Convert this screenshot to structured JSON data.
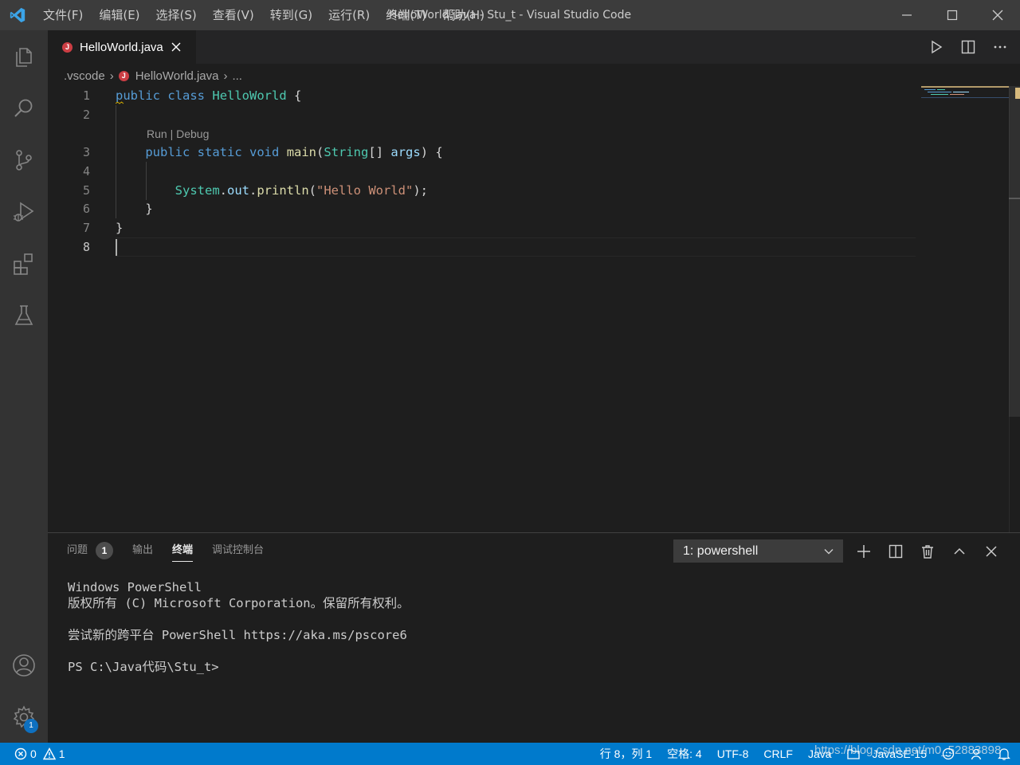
{
  "window": {
    "title": "HelloWorld.java - Stu_t - Visual Studio Code"
  },
  "menu": [
    "文件(F)",
    "编辑(E)",
    "选择(S)",
    "查看(V)",
    "转到(G)",
    "运行(R)",
    "终端(T)",
    "帮助(H)"
  ],
  "activity_bar": {
    "items": [
      "explorer-icon",
      "search-icon",
      "source-control-icon",
      "run-debug-icon",
      "extensions-icon",
      "testing-icon"
    ],
    "bottom": [
      "account-icon",
      "settings-gear-icon"
    ],
    "settings_badge": "1"
  },
  "tabs": [
    {
      "label": "HelloWorld.java",
      "icon": "J",
      "active": true
    }
  ],
  "breadcrumb": {
    "folder": ".vscode",
    "file": "HelloWorld.java",
    "more": "..."
  },
  "editor": {
    "line_numbers": [
      "1",
      "2",
      "3",
      "4",
      "5",
      "6",
      "7",
      "8"
    ],
    "codelens": "Run | Debug",
    "active_line": "8",
    "lines": {
      "l1_kw1": "public",
      "l1_kw2": "class",
      "l1_cls": "HelloWorld",
      "l1_rest": " {",
      "l3_kw1": "public",
      "l3_kw2": "static",
      "l3_kw3": "void",
      "l3_fn": "main",
      "l3_p1": "(",
      "l3_cls": "String",
      "l3_p2": "[] ",
      "l3_var": "args",
      "l3_p3": ") {",
      "l5_cls": "System",
      "l5_dot1": ".",
      "l5_var": "out",
      "l5_dot2": ".",
      "l5_fn": "println",
      "l5_p1": "(",
      "l5_str": "\"Hello World\"",
      "l5_p2": ");",
      "l6": "}",
      "l7": "}"
    }
  },
  "panel": {
    "tabs": [
      {
        "label": "问题",
        "badge": "1"
      },
      {
        "label": "输出"
      },
      {
        "label": "终端",
        "active": true
      },
      {
        "label": "调试控制台"
      }
    ],
    "terminal_select": "1: powershell",
    "terminal_lines": [
      "Windows PowerShell",
      "版权所有 (C) Microsoft Corporation。保留所有权利。",
      "",
      "尝试新的跨平台 PowerShell https://aka.ms/pscore6",
      "",
      "PS C:\\Java代码\\Stu_t>"
    ]
  },
  "statusbar": {
    "errors": "0",
    "warnings": "1",
    "position": "行 8，列 1",
    "spaces": "空格: 4",
    "encoding": "UTF-8",
    "eol": "CRLF",
    "language": "Java",
    "jdk": "JavaSE-15",
    "watermark": "https://blog.csdn.net/m0_52883898"
  },
  "colors": {
    "accent": "#007acc",
    "keyword": "#569cd6",
    "class": "#4ec9b0",
    "function": "#dcdcaa",
    "variable": "#9cdcfe",
    "string": "#ce9178"
  }
}
